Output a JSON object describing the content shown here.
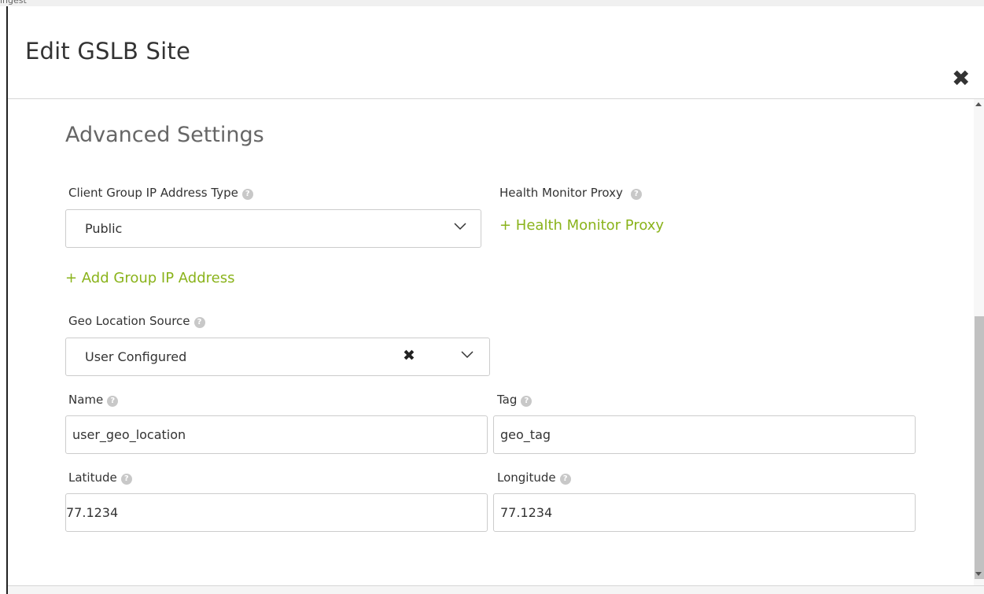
{
  "background": {
    "text": "ingest"
  },
  "modal": {
    "title": "Edit GSLB Site",
    "close_icon": "close-icon"
  },
  "advanced": {
    "section_title": "Advanced Settings",
    "client_group_ip_type": {
      "label": "Client Group IP Address Type",
      "value": "Public"
    },
    "health_monitor_proxy": {
      "label": "Health Monitor Proxy",
      "add_link": "+ Health Monitor Proxy"
    },
    "add_group_ip_link": "+ Add Group IP Address",
    "geo_location_source": {
      "label": "Geo Location Source",
      "value": "User Configured",
      "clear_icon": "✖"
    },
    "name": {
      "label": "Name",
      "value": "user_geo_location"
    },
    "tag": {
      "label": "Tag",
      "value": "geo_tag"
    },
    "latitude": {
      "label": "Latitude",
      "value": "77.1234"
    },
    "longitude": {
      "label": "Longitude",
      "value": "77.1234"
    }
  },
  "help_icon": "?",
  "colors": {
    "link": "#8ab31b",
    "border": "#cccccc",
    "text": "#333333"
  }
}
